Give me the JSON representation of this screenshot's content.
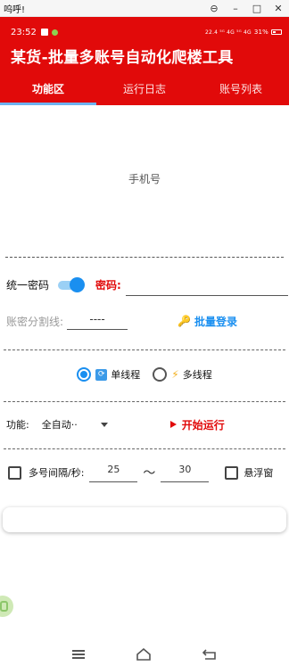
{
  "window": {
    "title": "呜呼!",
    "min": "–",
    "max": "□",
    "close": "✕",
    "help": "⊖"
  },
  "status": {
    "time": "23:52",
    "signal": "22.4 ⁵ᴳ 4G ⁵ᴳ 4G",
    "battery": "31%"
  },
  "app": {
    "title": "某货-批量多账号自动化爬楼工具"
  },
  "tabs": [
    {
      "label": "功能区"
    },
    {
      "label": "运行日志"
    },
    {
      "label": "账号列表"
    }
  ],
  "phone": {
    "label": "手机号"
  },
  "password_row": {
    "unified_label": "统一密码",
    "password_label": "密码:",
    "toggle_on": true
  },
  "separator_row": {
    "label": "账密分割线:",
    "value": "----",
    "batch_login": "批量登录"
  },
  "thread_row": {
    "single": "单线程",
    "multi": "多线程",
    "selected": "single"
  },
  "function_row": {
    "label": "功能:",
    "selected": "全自动··",
    "start": "开始运行"
  },
  "interval_row": {
    "label": "多号间隔/秒:",
    "from": "25",
    "tilde": "～",
    "to": "30",
    "float_label": "悬浮窗"
  },
  "colors": {
    "accent": "#e10a0a",
    "blue": "#1a8ff0"
  }
}
